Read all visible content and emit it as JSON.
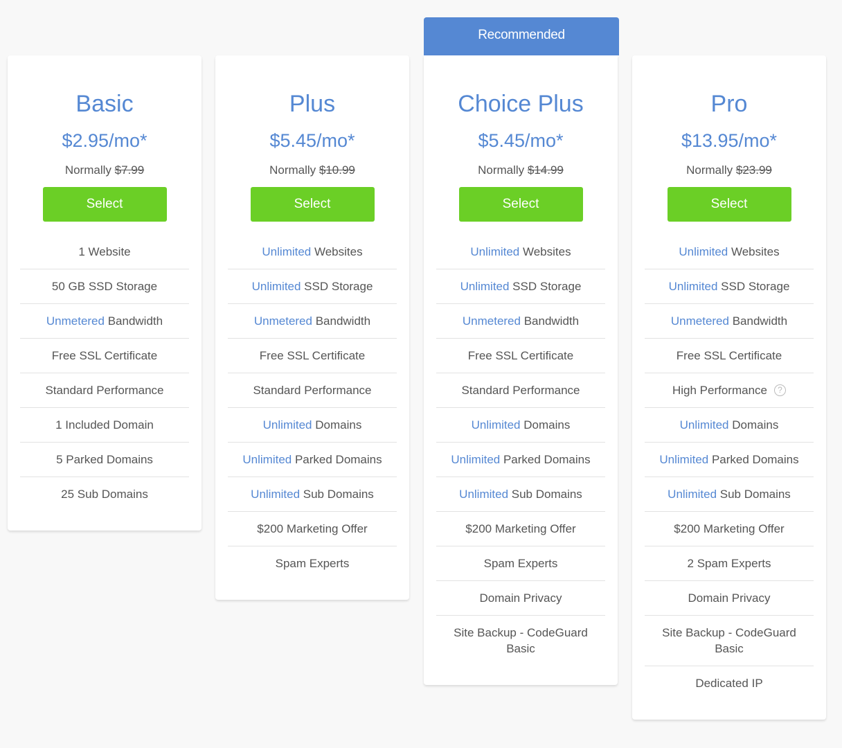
{
  "ribbon": "Recommended",
  "plans": [
    {
      "name": "Basic",
      "price": "$2.95/mo*",
      "normally_label": "Normally",
      "normal_price": "$7.99",
      "select_label": "Select",
      "features": [
        {
          "hl": "",
          "text": "1 Website"
        },
        {
          "hl": "",
          "text": "50 GB SSD Storage"
        },
        {
          "hl": "Unmetered",
          "text": " Bandwidth"
        },
        {
          "hl": "",
          "text": "Free SSL Certificate"
        },
        {
          "hl": "",
          "text": "Standard Performance"
        },
        {
          "hl": "",
          "text": "1 Included Domain"
        },
        {
          "hl": "",
          "text": "5 Parked Domains"
        },
        {
          "hl": "",
          "text": "25 Sub Domains"
        }
      ]
    },
    {
      "name": "Plus",
      "price": "$5.45/mo*",
      "normally_label": "Normally",
      "normal_price": "$10.99",
      "select_label": "Select",
      "features": [
        {
          "hl": "Unlimited",
          "text": " Websites"
        },
        {
          "hl": "Unlimited",
          "text": " SSD Storage"
        },
        {
          "hl": "Unmetered",
          "text": " Bandwidth"
        },
        {
          "hl": "",
          "text": "Free SSL Certificate"
        },
        {
          "hl": "",
          "text": "Standard Performance"
        },
        {
          "hl": "Unlimited",
          "text": " Domains"
        },
        {
          "hl": "Unlimited",
          "text": " Parked Domains"
        },
        {
          "hl": "Unlimited",
          "text": " Sub Domains"
        },
        {
          "hl": "",
          "text": "$200 Marketing Offer"
        },
        {
          "hl": "",
          "text": "Spam Experts"
        }
      ]
    },
    {
      "name": "Choice Plus",
      "price": "$5.45/mo*",
      "normally_label": "Normally",
      "normal_price": "$14.99",
      "select_label": "Select",
      "features": [
        {
          "hl": "Unlimited",
          "text": " Websites"
        },
        {
          "hl": "Unlimited",
          "text": " SSD Storage"
        },
        {
          "hl": "Unmetered",
          "text": " Bandwidth"
        },
        {
          "hl": "",
          "text": "Free SSL Certificate"
        },
        {
          "hl": "",
          "text": "Standard Performance"
        },
        {
          "hl": "Unlimited",
          "text": " Domains"
        },
        {
          "hl": "Unlimited",
          "text": " Parked Domains"
        },
        {
          "hl": "Unlimited",
          "text": " Sub Domains"
        },
        {
          "hl": "",
          "text": "$200 Marketing Offer"
        },
        {
          "hl": "",
          "text": "Spam Experts"
        },
        {
          "hl": "",
          "text": "Domain Privacy"
        },
        {
          "hl": "",
          "text": "Site Backup - CodeGuard Basic"
        }
      ]
    },
    {
      "name": "Pro",
      "price": "$13.95/mo*",
      "normally_label": "Normally",
      "normal_price": "$23.99",
      "select_label": "Select",
      "features": [
        {
          "hl": "Unlimited",
          "text": " Websites"
        },
        {
          "hl": "Unlimited",
          "text": " SSD Storage"
        },
        {
          "hl": "Unmetered",
          "text": " Bandwidth"
        },
        {
          "hl": "",
          "text": "Free SSL Certificate"
        },
        {
          "hl": "",
          "text": "High Performance",
          "help": "?"
        },
        {
          "hl": "Unlimited",
          "text": " Domains"
        },
        {
          "hl": "Unlimited",
          "text": " Parked Domains"
        },
        {
          "hl": "Unlimited",
          "text": " Sub Domains"
        },
        {
          "hl": "",
          "text": "$200 Marketing Offer"
        },
        {
          "hl": "",
          "text": "2 Spam Experts"
        },
        {
          "hl": "",
          "text": "Domain Privacy"
        },
        {
          "hl": "",
          "text": "Site Backup - CodeGuard Basic"
        },
        {
          "hl": "",
          "text": "Dedicated IP"
        }
      ]
    }
  ]
}
